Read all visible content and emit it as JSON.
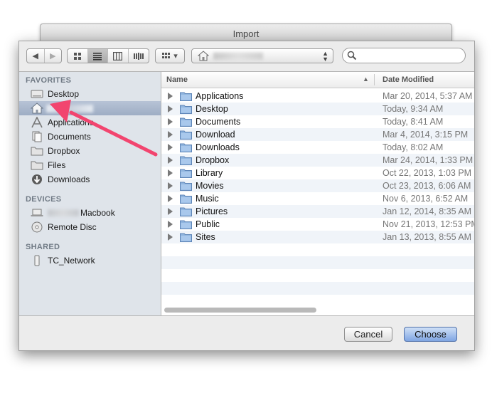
{
  "window": {
    "title": "Import"
  },
  "toolbar": {
    "back_label": "◀",
    "forward_label": "▶",
    "arrange_label": "▾",
    "search_placeholder": ""
  },
  "sidebar": {
    "favorites_header": "FAVORITES",
    "favorites": [
      {
        "label": "Desktop",
        "icon": "desktop-icon"
      },
      {
        "label": "",
        "icon": "home-icon"
      },
      {
        "label": "Applications",
        "icon": "applications-icon"
      },
      {
        "label": "Documents",
        "icon": "documents-icon"
      },
      {
        "label": "Dropbox",
        "icon": "folder-icon"
      },
      {
        "label": "Files",
        "icon": "folder-icon"
      },
      {
        "label": "Downloads",
        "icon": "downloads-icon"
      }
    ],
    "devices_header": "DEVICES",
    "devices": [
      {
        "label": "Macbook",
        "icon": "laptop-icon"
      },
      {
        "label": "Remote Disc",
        "icon": "disc-icon"
      }
    ],
    "shared_header": "SHARED",
    "shared": [
      {
        "label": "TC_Network",
        "icon": "time-capsule-icon"
      }
    ]
  },
  "file_list": {
    "column_name": "Name",
    "column_date": "Date Modified",
    "rows": [
      {
        "name": "Applications",
        "date": "Mar 20, 2014, 5:37 AM"
      },
      {
        "name": "Desktop",
        "date": "Today, 9:34 AM"
      },
      {
        "name": "Documents",
        "date": "Today, 8:41 AM"
      },
      {
        "name": "Download",
        "date": "Mar 4, 2014, 3:15 PM"
      },
      {
        "name": "Downloads",
        "date": "Today, 8:02 AM"
      },
      {
        "name": "Dropbox",
        "date": "Mar 24, 2014, 1:33 PM"
      },
      {
        "name": "Library",
        "date": "Oct 22, 2013, 1:03 PM"
      },
      {
        "name": "Movies",
        "date": "Oct 23, 2013, 6:06 AM"
      },
      {
        "name": "Music",
        "date": "Nov 6, 2013, 6:52 AM"
      },
      {
        "name": "Pictures",
        "date": "Jan 12, 2014, 8:35 AM"
      },
      {
        "name": "Public",
        "date": "Nov 21, 2013, 12:53 PM"
      },
      {
        "name": "Sites",
        "date": "Jan 13, 2013, 8:55 AM"
      }
    ]
  },
  "footer": {
    "cancel_label": "Cancel",
    "choose_label": "Choose"
  },
  "colors": {
    "accent_arrow": "#f2456f",
    "sidebar_bg": "#dfe4ea",
    "selection": "#a8b6cc"
  }
}
